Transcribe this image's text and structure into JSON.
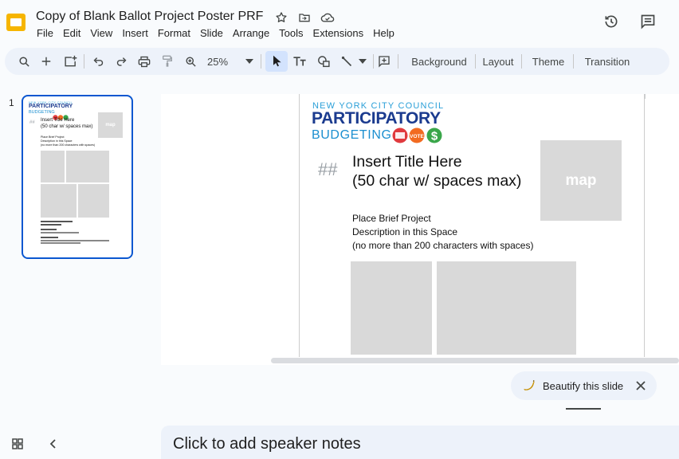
{
  "app": {
    "doc_title": "Copy of Blank Ballot Project Poster PRF",
    "logo_icon": "google-slides-logo",
    "title_icons": [
      "star-icon",
      "move-to-folder-icon",
      "cloud-saved-icon"
    ],
    "right_icons": [
      "version-history-icon",
      "comments-icon"
    ]
  },
  "menu": {
    "items": [
      "File",
      "Edit",
      "View",
      "Insert",
      "Format",
      "Slide",
      "Arrange",
      "Tools",
      "Extensions",
      "Help"
    ]
  },
  "toolbar": {
    "zoom": "25%",
    "background_label": "Background",
    "layout_label": "Layout",
    "theme_label": "Theme",
    "transition_label": "Transition"
  },
  "filmstrip": {
    "slide_number": "1",
    "thumb_council": "NEW YORK CITY COUNCIL",
    "thumb_particip": "PARTICIPATORY",
    "thumb_budget": "BUDGETING",
    "thumb_map": "map",
    "thumb_title_1": "Insert Title Here",
    "thumb_title_2": "(50 char w/ spaces max)",
    "thumb_desc_1": "Place Brief Project",
    "thumb_desc_2": "Description in this Space",
    "thumb_desc_3": "(no more than 200 characters with spaces)"
  },
  "slide": {
    "council": "NEW YORK CITY COUNCIL",
    "participatory": "PARTICIPATORY",
    "budgeting": "BUDGETING",
    "hash": "##",
    "title_line1": "Insert Title Here",
    "title_line2": "(50 char w/ spaces max)",
    "map_label": "map",
    "desc_line1": "Place Brief Project",
    "desc_line2": "Description in this Space",
    "desc_line3": "(no more than 200 characters with spaces)",
    "badge_vote": "VOTE",
    "badge_dollar": "$"
  },
  "beautify": {
    "label": "Beautify this slide"
  },
  "notes": {
    "placeholder": "Click to add speaker notes"
  },
  "colors": {
    "accent": "#0b57d0",
    "toolbar_bg": "#edf2fa",
    "navy": "#1b3b8f",
    "sky": "#2a9fd8",
    "badge_red": "#e03a3e",
    "badge_orange": "#f26b21",
    "badge_green": "#3aa64a",
    "placeholder_gray": "#d9d9d9"
  }
}
